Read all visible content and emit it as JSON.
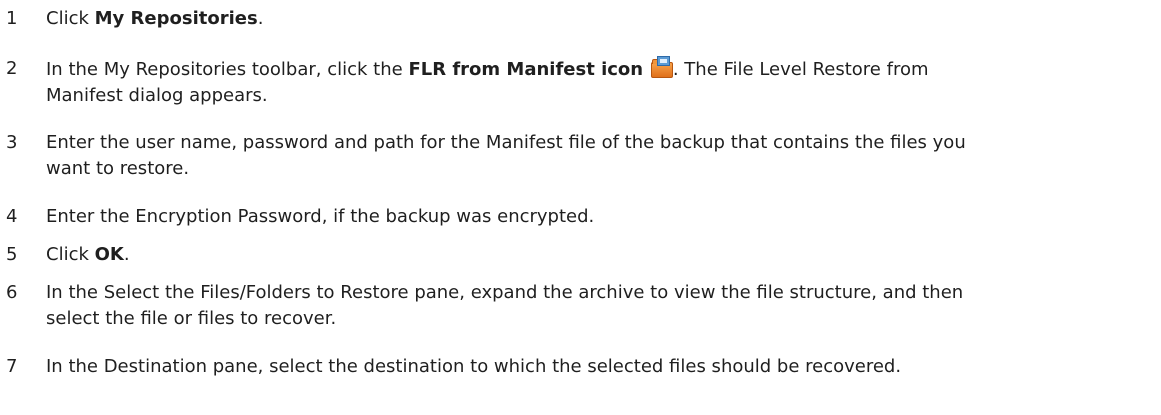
{
  "steps": [
    {
      "number": "1",
      "pre": "Click ",
      "bold": "My Repositories",
      "post": "."
    },
    {
      "number": "2",
      "pre": "In the My Repositories toolbar, click the ",
      "bold": "FLR from Manifest icon",
      "icon": "flr-from-manifest-folder-icon",
      "post_line1": ". The File Level Restore from",
      "post_line2": "Manifest dialog appears."
    },
    {
      "number": "3",
      "line1": "Enter the user name, password and path for the Manifest file of the backup that contains the files you",
      "line2": "want to restore."
    },
    {
      "number": "4",
      "line1": "Enter the Encryption Password, if the backup was encrypted."
    },
    {
      "number": "5",
      "pre": "Click ",
      "bold": "OK",
      "post": "."
    },
    {
      "number": "6",
      "line1": "In the Select the Files/Folders to Restore pane, expand the archive to view the file structure, and then",
      "line2": "select the file or files to recover."
    },
    {
      "number": "7",
      "line1": "In the Destination pane, select the destination to which the selected files should be recovered."
    }
  ]
}
